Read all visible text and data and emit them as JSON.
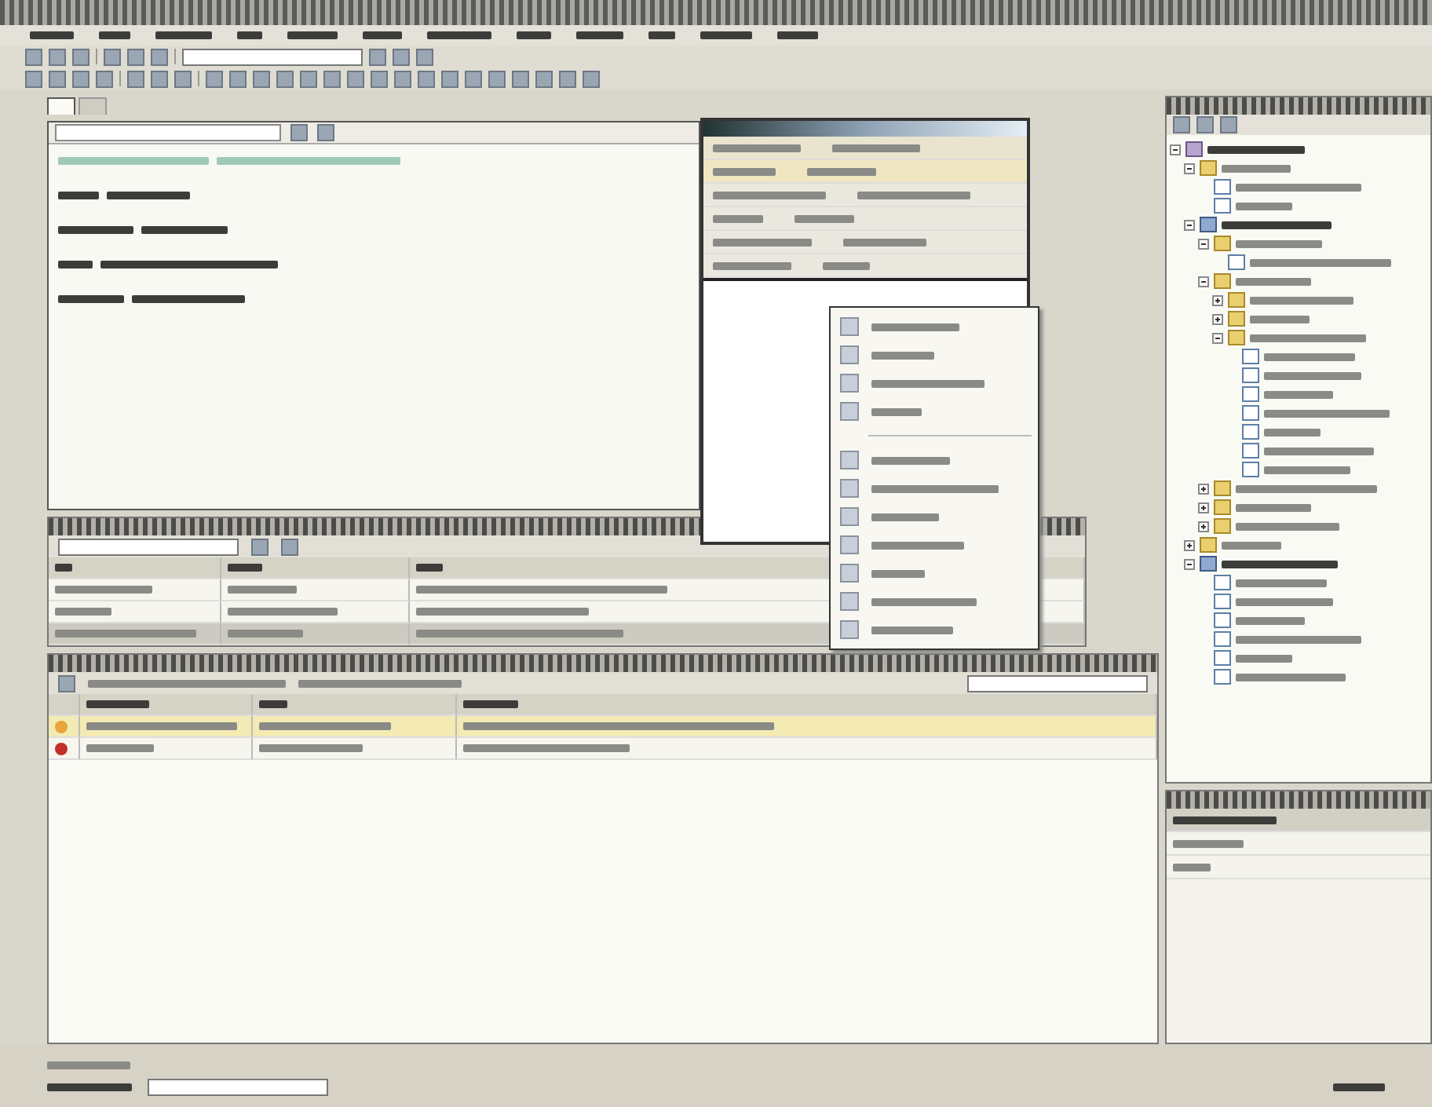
{
  "menu_bar": {
    "items": [
      {
        "kind": "menu"
      },
      {
        "kind": "menu"
      },
      {
        "kind": "menu"
      },
      {
        "kind": "menu"
      },
      {
        "kind": "menu"
      },
      {
        "kind": "menu"
      },
      {
        "kind": "menu"
      },
      {
        "kind": "menu"
      },
      {
        "kind": "menu"
      },
      {
        "kind": "menu"
      },
      {
        "kind": "menu"
      },
      {
        "kind": "menu"
      }
    ]
  },
  "toolbars": [
    {
      "items": [
        {
          "kind": "icon"
        },
        {
          "kind": "icon"
        },
        {
          "kind": "icon"
        },
        {
          "kind": "separator"
        },
        {
          "kind": "icon"
        },
        {
          "kind": "icon"
        },
        {
          "kind": "icon"
        },
        {
          "kind": "separator"
        },
        {
          "kind": "combo"
        },
        {
          "kind": "icon"
        },
        {
          "kind": "icon"
        },
        {
          "kind": "icon"
        }
      ]
    },
    {
      "items": [
        {
          "kind": "icon"
        },
        {
          "kind": "icon"
        },
        {
          "kind": "icon"
        },
        {
          "kind": "icon"
        },
        {
          "kind": "separator"
        },
        {
          "kind": "icon"
        },
        {
          "kind": "icon"
        },
        {
          "kind": "icon"
        },
        {
          "kind": "separator"
        },
        {
          "kind": "icon"
        },
        {
          "kind": "icon"
        },
        {
          "kind": "icon"
        },
        {
          "kind": "icon"
        },
        {
          "kind": "icon"
        },
        {
          "kind": "icon"
        },
        {
          "kind": "icon"
        },
        {
          "kind": "icon"
        },
        {
          "kind": "icon"
        },
        {
          "kind": "icon"
        },
        {
          "kind": "icon"
        },
        {
          "kind": "icon"
        },
        {
          "kind": "icon"
        },
        {
          "kind": "icon"
        },
        {
          "kind": "icon"
        },
        {
          "kind": "icon"
        },
        {
          "kind": "icon"
        }
      ]
    }
  ],
  "document_tabs": [
    {
      "selected": true
    },
    {
      "selected": false
    }
  ],
  "editor": {
    "lines": [
      {
        "kind": "comment"
      },
      {
        "kind": "code"
      },
      {
        "kind": "code"
      },
      {
        "kind": "code"
      },
      {
        "kind": "code"
      }
    ]
  },
  "datatip": {
    "rows": [
      {
        "kind": "header"
      },
      {
        "kind": "item",
        "selected": true
      },
      {
        "kind": "item",
        "selected": false
      },
      {
        "kind": "item",
        "selected": false
      },
      {
        "kind": "item",
        "selected": false
      },
      {
        "kind": "item",
        "selected": false
      }
    ]
  },
  "context_menu": {
    "items": [
      {
        "kind": "item"
      },
      {
        "kind": "item"
      },
      {
        "kind": "item"
      },
      {
        "kind": "item"
      },
      {
        "kind": "separator"
      },
      {
        "kind": "item"
      },
      {
        "kind": "item"
      },
      {
        "kind": "item"
      },
      {
        "kind": "item"
      },
      {
        "kind": "item"
      },
      {
        "kind": "item"
      },
      {
        "kind": "item"
      }
    ]
  },
  "locals": {
    "columns": [
      {
        "kind": "column"
      },
      {
        "kind": "column"
      },
      {
        "kind": "column"
      }
    ],
    "rows": [
      {
        "selected": false
      },
      {
        "selected": false
      },
      {
        "selected": true
      }
    ]
  },
  "error_list": {
    "columns": [
      {
        "kind": "column"
      },
      {
        "kind": "column"
      },
      {
        "kind": "column"
      },
      {
        "kind": "column"
      }
    ],
    "rows": [
      {
        "kind": "warning",
        "selected": true
      },
      {
        "kind": "error",
        "selected": false
      }
    ]
  },
  "solution_explorer": {
    "tree": [
      {
        "kind": "solution",
        "expanded": true,
        "children": [
          {
            "kind": "folder",
            "expanded": true,
            "children": [
              {
                "kind": "file"
              },
              {
                "kind": "file"
              }
            ]
          },
          {
            "kind": "project",
            "expanded": true,
            "children": [
              {
                "kind": "folder",
                "expanded": true,
                "children": [
                  {
                    "kind": "file"
                  }
                ]
              },
              {
                "kind": "folder",
                "expanded": true,
                "children": [
                  {
                    "kind": "folder",
                    "expanded": false
                  },
                  {
                    "kind": "folder",
                    "expanded": false
                  },
                  {
                    "kind": "folder",
                    "expanded": true,
                    "children": [
                      {
                        "kind": "file"
                      },
                      {
                        "kind": "file"
                      },
                      {
                        "kind": "file"
                      },
                      {
                        "kind": "file"
                      },
                      {
                        "kind": "file"
                      },
                      {
                        "kind": "file"
                      },
                      {
                        "kind": "file"
                      }
                    ]
                  }
                ]
              },
              {
                "kind": "folder",
                "expanded": false
              },
              {
                "kind": "folder",
                "expanded": false
              },
              {
                "kind": "folder",
                "expanded": false
              }
            ]
          },
          {
            "kind": "folder",
            "expanded": false
          },
          {
            "kind": "project",
            "expanded": true,
            "children": [
              {
                "kind": "file"
              },
              {
                "kind": "file"
              },
              {
                "kind": "file"
              },
              {
                "kind": "file"
              },
              {
                "kind": "file"
              },
              {
                "kind": "file"
              }
            ]
          }
        ]
      }
    ]
  },
  "properties": {
    "rows": [
      {
        "kind": "category"
      },
      {
        "kind": "property"
      },
      {
        "kind": "property"
      }
    ]
  }
}
